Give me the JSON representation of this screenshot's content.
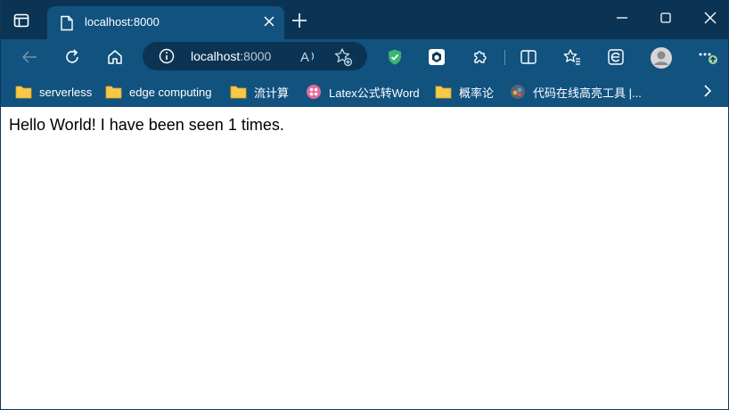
{
  "tab": {
    "title": "localhost:8000",
    "icon": "page-icon"
  },
  "window_controls": [
    "minimize-icon",
    "maximize-icon",
    "close-icon"
  ],
  "address": {
    "host": "localhost",
    "port": ":8000"
  },
  "bookmarks": [
    {
      "label": "serverless",
      "icon": "folder-icon"
    },
    {
      "label": "edge computing",
      "icon": "folder-icon"
    },
    {
      "label": "流计算",
      "icon": "folder-icon"
    },
    {
      "label": "Latex公式转Word",
      "icon": "latex-site-icon"
    },
    {
      "label": "概率论",
      "icon": "folder-icon"
    },
    {
      "label": "代码在线高亮工具 |...",
      "icon": "highlight-site-icon"
    }
  ],
  "colors": {
    "titlebar": "#0b3454",
    "toolbar": "#11527f",
    "folder": "#f6c94b"
  },
  "content": {
    "message": "Hello World! I have been seen 1 times."
  }
}
